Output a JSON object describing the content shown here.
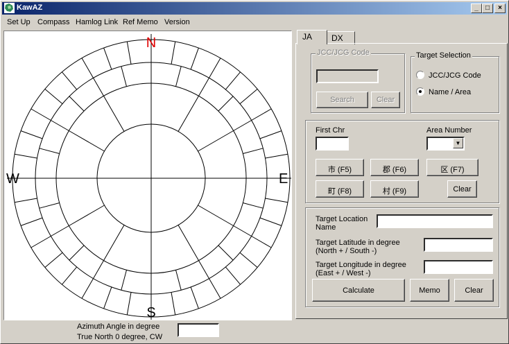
{
  "window": {
    "title": "KawAZ",
    "minimize": "_",
    "maximize": "□",
    "close": "×"
  },
  "menu": [
    {
      "label": "Set Up"
    },
    {
      "label": "Compass"
    },
    {
      "label": "Hamlog Link"
    },
    {
      "label": "Ref Memo"
    },
    {
      "label": "Version"
    }
  ],
  "compass": {
    "north": "N",
    "south": "S",
    "east": "E",
    "west": "W"
  },
  "azimuth": {
    "line1": "Azimuth Angle in degree",
    "line2": "True North 0 degree, CW",
    "value": ""
  },
  "tabs": [
    {
      "label": "JA"
    },
    {
      "label": "DX"
    }
  ],
  "jcc": {
    "legend": "JCC/JCG Code",
    "value": "",
    "search": "Search",
    "clear": "Clear"
  },
  "target_selection": {
    "legend": "Target Selection",
    "opt1": "JCC/JCG Code",
    "opt2": "Name / Area",
    "selected": "Name / Area"
  },
  "area": {
    "first_chr_label": "First Chr",
    "first_chr_value": "",
    "area_number_label": "Area Number",
    "area_number_value": "",
    "btn_shi": "市 (F5)",
    "btn_gun": "郡 (F6)",
    "btn_ku": "区 (F7)",
    "btn_machi": "町 (F8)",
    "btn_mura": "村 (F9)",
    "clear": "Clear"
  },
  "location": {
    "name_label1": "Target Location",
    "name_label2": "Name",
    "name_value": "",
    "lat_label1": "Target Latitude in degree",
    "lat_label2": "(North + / South -)",
    "lat_value": "",
    "lon_label1": "Target Longitude in degree",
    "lon_label2": "(East + / West -)",
    "lon_value": "",
    "calculate": "Calculate",
    "memo": "Memo",
    "clear": "Clear"
  }
}
